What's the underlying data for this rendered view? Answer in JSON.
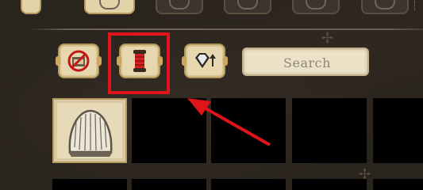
{
  "top_tabs": [
    {
      "name": "top-tab-1",
      "state": "light"
    },
    {
      "name": "top-tab-2-selected",
      "state": "light"
    },
    {
      "name": "top-tab-3",
      "state": "dark"
    },
    {
      "name": "top-tab-4",
      "state": "dark"
    },
    {
      "name": "top-tab-5",
      "state": "dark"
    },
    {
      "name": "top-tab-6",
      "state": "dark"
    }
  ],
  "filters": [
    {
      "name": "filter-crafting-station-off",
      "icon": "no-station-icon"
    },
    {
      "name": "filter-spool-selected",
      "icon": "spool-icon",
      "selected": true
    },
    {
      "name": "filter-gem-upgrade",
      "icon": "gem-arrow-icon"
    }
  ],
  "search": {
    "placeholder": "Search",
    "value": ""
  },
  "grid": {
    "selected_item": "hairy-hat-icon"
  },
  "annotation": {
    "color": "#e0141a"
  },
  "colors": {
    "panel": "#e6d7ae",
    "border": "#b4975b",
    "background": "#2a241e",
    "slot": "#000000"
  }
}
